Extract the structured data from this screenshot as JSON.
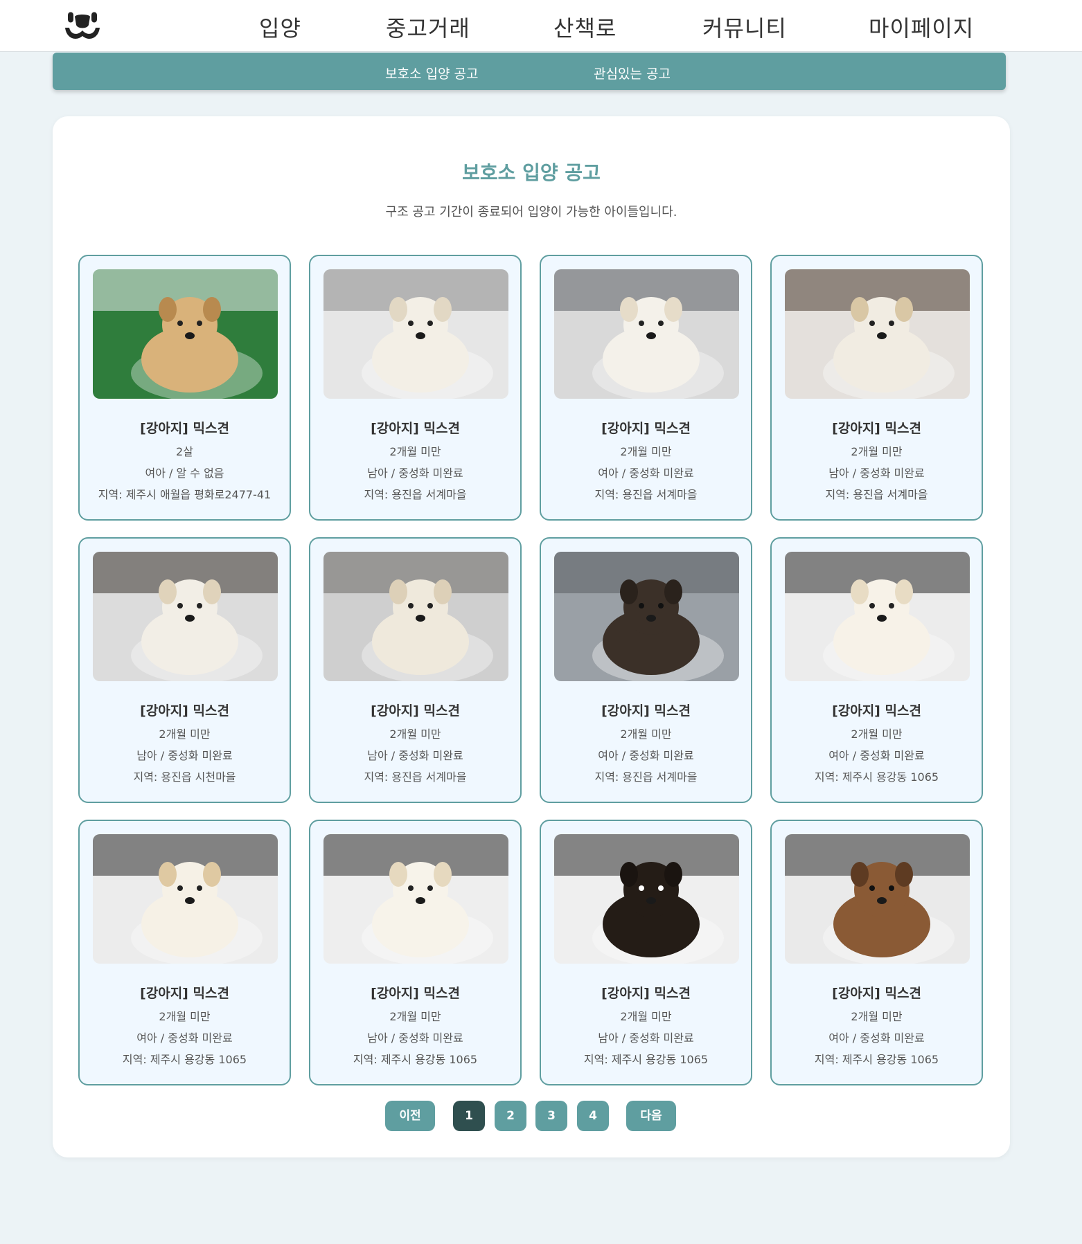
{
  "nav": {
    "items": [
      "입양",
      "중고거래",
      "산책로",
      "커뮤니티",
      "마이페이지"
    ]
  },
  "subnav": {
    "items": [
      "보호소 입양 공고",
      "관심있는 공고"
    ]
  },
  "page": {
    "title": "보호소 입양 공고",
    "subtitle": "구조 공고 기간이 종료되어 입양이 가능한 아이들입니다."
  },
  "cards": [
    {
      "title": "[강아지] 믹스견",
      "age": "2살",
      "sex": "여아 / 알 수 없음",
      "region": "지역: 제주시 애월읍 평화로2477-41",
      "photo": "lab-on-grass"
    },
    {
      "title": "[강아지] 믹스견",
      "age": "2개월 미만",
      "sex": "남아 / 중성화 미완료",
      "region": "지역: 용진읍 서계마을",
      "photo": "white-puppy-pad"
    },
    {
      "title": "[강아지] 믹스견",
      "age": "2개월 미만",
      "sex": "여아 / 중성화 미완료",
      "region": "지역: 용진읍 서계마을",
      "photo": "white-puppy-lying"
    },
    {
      "title": "[강아지] 믹스견",
      "age": "2개월 미만",
      "sex": "남아 / 중성화 미완료",
      "region": "지역: 용진읍 서계마을",
      "photo": "white-puppy-sitting"
    },
    {
      "title": "[강아지] 믹스견",
      "age": "2개월 미만",
      "sex": "남아 / 중성화 미완료",
      "region": "지역: 용진읍 시천마을",
      "photo": "white-puppy-standing"
    },
    {
      "title": "[강아지] 믹스견",
      "age": "2개월 미만",
      "sex": "남아 / 중성화 미완료",
      "region": "지역: 용진읍 서계마을",
      "photo": "white-puppy-table"
    },
    {
      "title": "[강아지] 믹스견",
      "age": "2개월 미만",
      "sex": "여아 / 중성화 미완료",
      "region": "지역: 용진읍 서계마을",
      "photo": "dark-puppy"
    },
    {
      "title": "[강아지] 믹스견",
      "age": "2개월 미만",
      "sex": "여아 / 중성화 미완료",
      "region": "지역: 제주시 용강동 1065",
      "photo": "white-puppy-held"
    },
    {
      "title": "[강아지] 믹스견",
      "age": "2개월 미만",
      "sex": "여아 / 중성화 미완료",
      "region": "지역: 제주시 용강동 1065",
      "photo": "white-puppy-held-2"
    },
    {
      "title": "[강아지] 믹스견",
      "age": "2개월 미만",
      "sex": "남아 / 중성화 미완료",
      "region": "지역: 제주시 용강동 1065",
      "photo": "white-puppy-held-3"
    },
    {
      "title": "[강아지] 믹스견",
      "age": "2개월 미만",
      "sex": "남아 / 중성화 미완료",
      "region": "지역: 제주시 용강동 1065",
      "photo": "black-tan-puppy"
    },
    {
      "title": "[강아지] 믹스견",
      "age": "2개월 미만",
      "sex": "여아 / 중성화 미완료",
      "region": "지역: 제주시 용강동 1065",
      "photo": "brown-puppy"
    }
  ],
  "pagination": {
    "prev": "이전",
    "pages": [
      "1",
      "2",
      "3",
      "4"
    ],
    "current": "1",
    "next": "다음"
  },
  "colors": {
    "accent": "#5f9ea0",
    "active_page": "#2f4f4f",
    "card_bg": "#f0f8ff",
    "page_bg": "#ecf3f6"
  }
}
